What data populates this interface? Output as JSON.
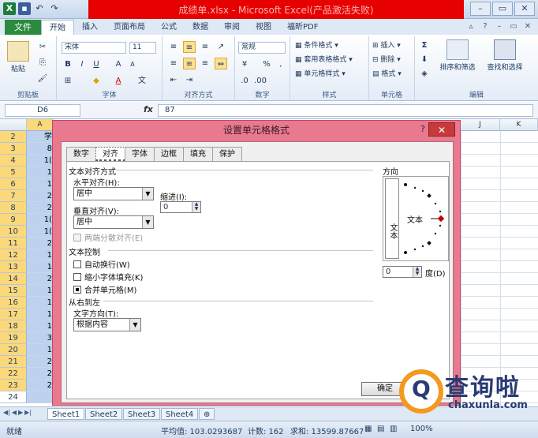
{
  "window": {
    "title": "成绩单.xlsx - Microsoft Excel(产品激活失败)",
    "title_bg": "#e60000"
  },
  "qat": {
    "app_icon": "X",
    "undo": "↶",
    "redo": "↷"
  },
  "ribbon_tabs": [
    "文件",
    "开始",
    "插入",
    "页面布局",
    "公式",
    "数据",
    "审阅",
    "视图",
    "福昕PDF"
  ],
  "ribbon": {
    "clipboard": {
      "paste": "粘贴",
      "label": "剪贴板"
    },
    "font": {
      "name": "宋体",
      "size": "11",
      "bold": "B",
      "italic": "I",
      "underline": "U",
      "grow": "A",
      "shrink": "A",
      "color": "A",
      "label": "字体"
    },
    "alignment": {
      "label": "对齐方式"
    },
    "number": {
      "format": "常规",
      "percent": "%",
      "comma": ",",
      "label": "数字"
    },
    "styles": {
      "conditional": "条件格式",
      "table": "套用表格格式",
      "cell": "单元格样式",
      "label": "样式"
    },
    "cells": {
      "insert": "插入",
      "delete": "删除",
      "format": "格式",
      "label": "单元格"
    },
    "editing": {
      "sigma": "Σ",
      "sort": "排序和筛选",
      "find": "查找和选择",
      "label": "编辑"
    }
  },
  "formula_bar": {
    "cell_ref": "D6",
    "fx": "fx",
    "value": "87"
  },
  "grid": {
    "columns": [
      "A",
      "J",
      "K"
    ],
    "rows": [
      "2",
      "3",
      "4",
      "5",
      "6",
      "7",
      "8",
      "9",
      "10",
      "11",
      "12",
      "13",
      "14",
      "15",
      "16",
      "17",
      "18",
      "19",
      "20",
      "21",
      "22",
      "23",
      "24"
    ],
    "colA_values": [
      "学",
      "8",
      "1(",
      "1",
      "1",
      "2",
      "2",
      "1(",
      "1(",
      "2",
      "1",
      "1",
      "2",
      "1",
      "1",
      "1",
      "1",
      "3",
      "1",
      "2",
      "2",
      "2",
      ""
    ]
  },
  "dialog": {
    "title": "设置单元格格式",
    "help": "?",
    "close": "✕",
    "tabs": [
      "数字",
      "对齐",
      "字体",
      "边框",
      "填充",
      "保护"
    ],
    "active_tab": "对齐",
    "text_alignment": "文本对齐方式",
    "horizontal_label": "水平对齐(H):",
    "horizontal_value": "居中",
    "indent_label": "缩进(I):",
    "indent_value": "0",
    "vertical_label": "垂直对齐(V):",
    "vertical_value": "居中",
    "distributed": "两端分散对齐(E)",
    "text_control": "文本控制",
    "wrap": "自动换行(W)",
    "shrink": "缩小字体填充(K)",
    "merge": "合并单元格(M)",
    "rtl": "从右到左",
    "direction_label": "文字方向(T):",
    "direction_value": "根据内容",
    "orientation": "方向",
    "vertical_text": "文本",
    "dial_text": "文本",
    "degree_value": "0",
    "degree_label": "度(D)",
    "ok": "确定"
  },
  "sheets": [
    "Sheet1",
    "Sheet2",
    "Sheet3",
    "Sheet4"
  ],
  "status": {
    "ready": "就绪",
    "average": "平均值: 103.0293687",
    "count": "计数: 162",
    "sum": "求和: 13599.87667",
    "zoom": "100%"
  },
  "watermark": {
    "name": "查询啦",
    "url": "chaxunla.com"
  }
}
